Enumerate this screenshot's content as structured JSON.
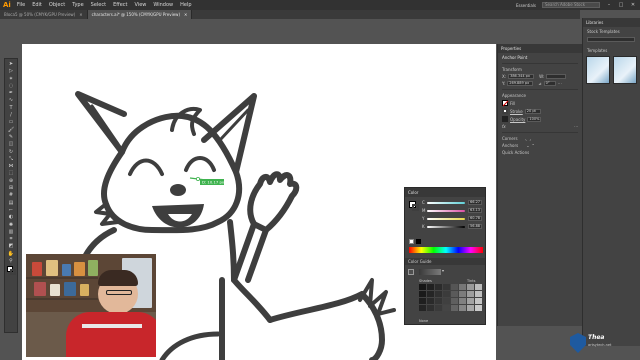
{
  "app": {
    "logo": "Ai",
    "menu": [
      "File",
      "Edit",
      "Object",
      "Type",
      "Select",
      "Effect",
      "View",
      "Window",
      "Help"
    ]
  },
  "topbar": {
    "workspace": "Essentials",
    "search_placeholder": "Search Adobe Stock"
  },
  "tabs": [
    {
      "label": "Bloca5 @ 50% (CMYK/GPU Preview)"
    },
    {
      "label": "characters.ai* @ 150% (CMYK/GPU Preview)"
    }
  ],
  "canvas": {
    "measure_label": "D: 10.17 px"
  },
  "properties": {
    "title": "Properties",
    "subject": "Anchor Point",
    "transform_heading": "Transform",
    "x_label": "X:",
    "x_value": "386.344 px",
    "y_label": "Y:",
    "y_value": "269.889 px",
    "w_label": "W:",
    "w_value": "",
    "rotate_value": "0°",
    "appearance_heading": "Appearance",
    "fill_label": "Fill",
    "stroke_label": "Stroke",
    "stroke_value": "20 pt",
    "opacity_label": "Opacity",
    "opacity_value": "100%",
    "fx_label": "fx",
    "corners_heading": "Corners",
    "anchors_heading": "Anchors",
    "quick_actions_heading": "Quick Actions"
  },
  "libraries": {
    "title": "Libraries",
    "subtitle": "Stock Templates",
    "items_label": "Templates"
  },
  "color_panel": {
    "title": "Color",
    "channels": [
      {
        "label": "C",
        "value": "66.27",
        "color": "#5fd0d6"
      },
      {
        "label": "M",
        "value": "63.13",
        "color": "#d94fa3"
      },
      {
        "label": "Y",
        "value": "60.78",
        "color": "#e8d94b"
      },
      {
        "label": "K",
        "value": "56.88",
        "color": "#3a3a3a"
      }
    ],
    "guide_title": "Color Guide",
    "guide_left": "Shades",
    "guide_right": "Tints",
    "guide_footer": "None"
  },
  "watermark": {
    "text": "Thea",
    "subtext": "artsytech.net"
  },
  "colors": {
    "accent": "#ff9a00",
    "panel": "#434343",
    "chrome": "#323232",
    "stroke": "#3e3e3e"
  }
}
